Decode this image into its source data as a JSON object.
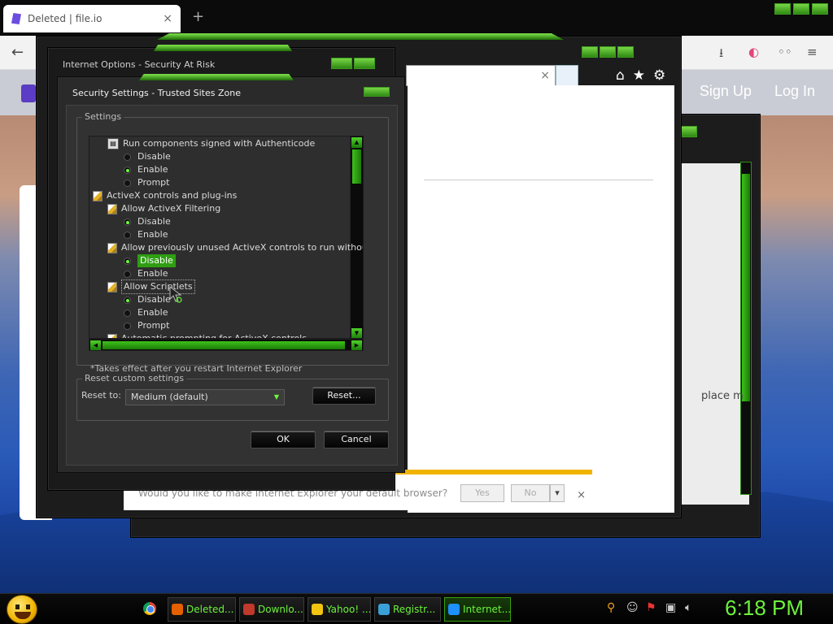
{
  "chrome": {
    "tab_title": "Deleted | file.io",
    "tab_close": "×",
    "new_tab": "+"
  },
  "site": {
    "sign_up": "Sign Up",
    "log_in": "Log In",
    "partial_text": "place m"
  },
  "internet_options": {
    "title": "Internet Options - Security At Risk"
  },
  "security_dialog": {
    "title": "Security Settings - Trusted Sites Zone",
    "settings_group": "Settings",
    "tree": [
      {
        "type": "header",
        "label": "Run components signed with Authenticode",
        "indent": 1
      },
      {
        "type": "radio",
        "label": "Disable",
        "checked": false,
        "indent": 2
      },
      {
        "type": "radio",
        "label": "Enable",
        "checked": true,
        "indent": 2
      },
      {
        "type": "radio",
        "label": "Prompt",
        "checked": false,
        "indent": 2
      },
      {
        "type": "header",
        "label": "ActiveX controls and plug-ins",
        "indent": 0
      },
      {
        "type": "header",
        "label": "Allow ActiveX Filtering",
        "indent": 1
      },
      {
        "type": "radio",
        "label": "Disable",
        "checked": true,
        "indent": 2
      },
      {
        "type": "radio",
        "label": "Enable",
        "checked": false,
        "indent": 2
      },
      {
        "type": "header",
        "label": "Allow previously unused ActiveX controls to run without prom",
        "indent": 1
      },
      {
        "type": "radio",
        "label": "Disable",
        "checked": true,
        "indent": 2,
        "selected": true
      },
      {
        "type": "radio",
        "label": "Enable",
        "checked": false,
        "indent": 2
      },
      {
        "type": "header",
        "label": "Allow Scriptlets",
        "indent": 1,
        "focused": true
      },
      {
        "type": "radio",
        "label": "Disable",
        "checked": true,
        "indent": 2
      },
      {
        "type": "radio",
        "label": "Enable",
        "checked": false,
        "indent": 2
      },
      {
        "type": "radio",
        "label": "Prompt",
        "checked": false,
        "indent": 2
      },
      {
        "type": "header",
        "label": "Automatic prompting for ActiveX controls",
        "indent": 1
      }
    ],
    "restart_note": "*Takes effect after you restart Internet Explorer",
    "reset_group": "Reset custom settings",
    "reset_to_label": "Reset to:",
    "reset_to_value": "Medium (default)",
    "reset_button": "Reset...",
    "ok_button": "OK",
    "cancel_button": "Cancel"
  },
  "ie": {
    "address_close": "×"
  },
  "notification": {
    "message": "Would you like to make Internet Explorer your default browser?",
    "yes": "Yes",
    "no": "No",
    "close": "×"
  },
  "taskbar": {
    "items": [
      {
        "label": "Deleted...",
        "icon_color": "#e66000"
      },
      {
        "label": "Downlo...",
        "icon_color": "#c0392b"
      },
      {
        "label": "Yahoo! ...",
        "icon_color": "#f1c40f"
      },
      {
        "label": "Registr...",
        "icon_color": "#3aa0d8"
      },
      {
        "label": "Internet...",
        "icon_color": "#1e90ff",
        "active": true
      }
    ],
    "clock": "6:18 PM"
  },
  "colors": {
    "accent_green": "#6cf23c",
    "selection_green": "#2f9e13",
    "notification_bar": "#f0b400"
  }
}
